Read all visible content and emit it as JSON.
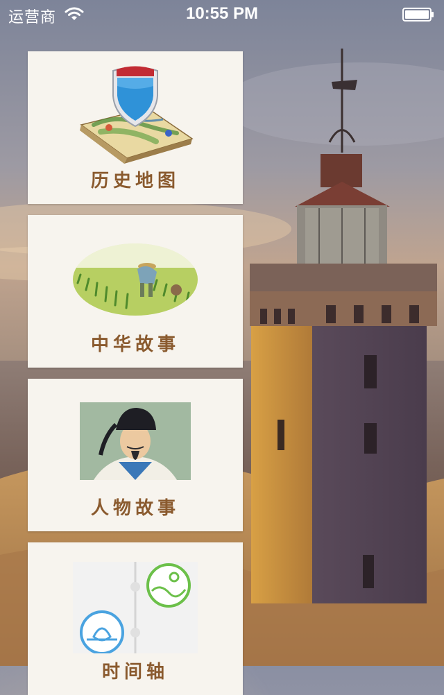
{
  "status_bar": {
    "carrier": "运营商",
    "time": "10:55 PM"
  },
  "icons": {
    "wifi": "wifi-icon",
    "battery": "battery-icon"
  },
  "menu": [
    {
      "label": "历史地图",
      "icon": "map-shield-icon"
    },
    {
      "label": "中华故事",
      "icon": "farmer-illustration"
    },
    {
      "label": "人物故事",
      "icon": "portrait-illustration"
    },
    {
      "label": "时间轴",
      "icon": "timeline-icon"
    }
  ],
  "colors": {
    "card_bg": "#f7f4ee",
    "label": "#8a5a2e",
    "timeline_green": "#6cc04a",
    "timeline_blue": "#4aa3e0"
  }
}
